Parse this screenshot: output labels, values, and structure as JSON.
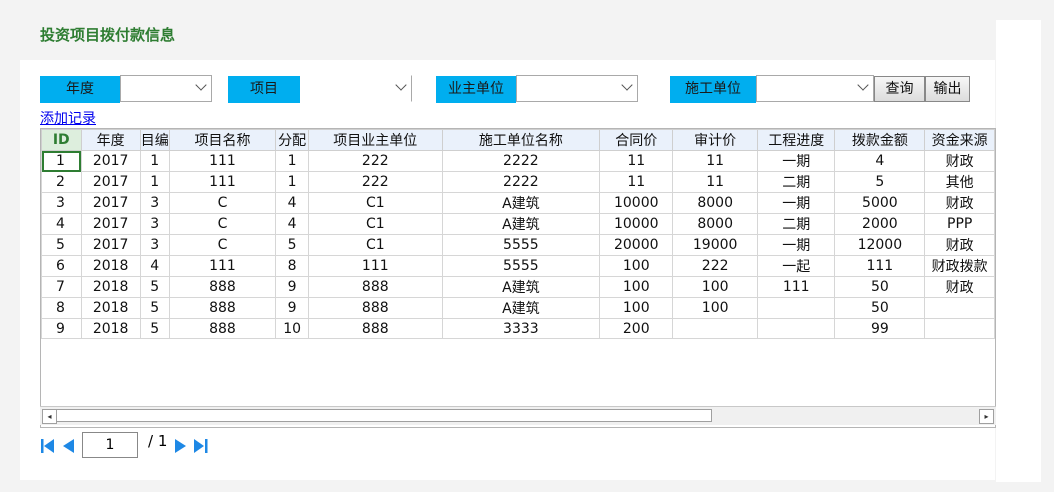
{
  "title": "投资项目拨付款信息",
  "filters": {
    "year_label": "年度",
    "project_label": "项目",
    "owner_label": "业主单位",
    "contractor_label": "施工单位",
    "query_button": "查询",
    "export_button": "输出"
  },
  "add_record": "添加记录",
  "columns": [
    "ID",
    "年度",
    "目编",
    "项目名称",
    "分配",
    "项目业主单位",
    "施工单位名称",
    "合同价",
    "审计价",
    "工程进度",
    "拨款金额",
    "资金来源"
  ],
  "rows": [
    [
      "1",
      "2017",
      "1",
      "111",
      "1",
      "222",
      "2222",
      "11",
      "11",
      "一期",
      "4",
      "财政"
    ],
    [
      "2",
      "2017",
      "1",
      "111",
      "1",
      "222",
      "2222",
      "11",
      "11",
      "二期",
      "5",
      "其他"
    ],
    [
      "3",
      "2017",
      "3",
      "C",
      "4",
      "C1",
      "A建筑",
      "10000",
      "8000",
      "一期",
      "5000",
      "财政"
    ],
    [
      "4",
      "2017",
      "3",
      "C",
      "4",
      "C1",
      "A建筑",
      "10000",
      "8000",
      "二期",
      "2000",
      "PPP"
    ],
    [
      "5",
      "2017",
      "3",
      "C",
      "5",
      "C1",
      "5555",
      "20000",
      "19000",
      "一期",
      "12000",
      "财政"
    ],
    [
      "6",
      "2018",
      "4",
      "111",
      "8",
      "111",
      "5555",
      "100",
      "222",
      "一起",
      "111",
      "财政拨款"
    ],
    [
      "7",
      "2018",
      "5",
      "888",
      "9",
      "888",
      "A建筑",
      "100",
      "100",
      "111",
      "50",
      "财政"
    ],
    [
      "8",
      "2018",
      "5",
      "888",
      "9",
      "888",
      "A建筑",
      "100",
      "100",
      "",
      "50",
      ""
    ],
    [
      "9",
      "2018",
      "5",
      "888",
      "10",
      "888",
      "3333",
      "200",
      "",
      "",
      "99",
      ""
    ]
  ],
  "pager": {
    "current_page": "1",
    "total": "/ 1"
  },
  "colors": {
    "accent": "#00aeef",
    "title": "#2e7d32",
    "pager_icon": "#1e88e5"
  }
}
